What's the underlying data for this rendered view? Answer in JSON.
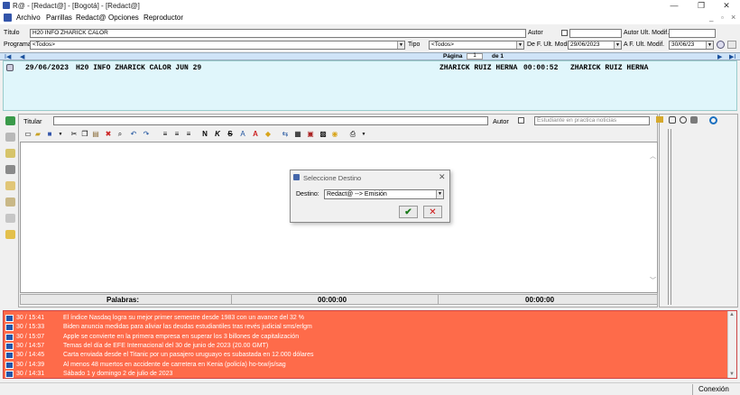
{
  "window": {
    "title": "R@ - [Redact@] - [Bogotá] - [Redact@]",
    "minimize": "—",
    "restore": "❐",
    "close": "✕",
    "child_controls": [
      "_",
      "▫",
      "×"
    ]
  },
  "menu": [
    "Archivo",
    "Parrillas",
    "Redact@",
    "Opciones",
    "Reproductor"
  ],
  "form": {
    "titulo_label": "Título",
    "titulo_value": "H20 INFO ZHARICK CALOR",
    "autor_label": "Autor",
    "autor_ult_modif_label": "Autor Ult. Modif.",
    "programa_label": "Programa",
    "programa_value": "<Todos>",
    "tipo_label": "Tipo",
    "tipo_value": "<Todos>",
    "de_f_label": "De F. Ult. Modif.",
    "de_f_value": "29/06/2023",
    "a_f_label": "A F. Ult. Modif.",
    "a_f_value": "30/06/23"
  },
  "nav": {
    "first": "I◀",
    "prev": "◀",
    "pagina_label": "Página",
    "pagina_value": "1",
    "de_label": "de 1",
    "next": "▶",
    "last": "▶I"
  },
  "news_item": {
    "date": "29/06/2023",
    "title": "H20 INFO ZHARICK CALOR JUN 29",
    "author": "ZHARICK RUIZ HERNA",
    "duration": "00:00:52",
    "modifier": "ZHARICK RUIZ HERNA"
  },
  "editor": {
    "titular_label": "Titular",
    "titular_value": "",
    "autor_label": "Autor",
    "autor_value": "Estudiante en practica noticias",
    "toolbar": [
      "new",
      "open",
      "save",
      "cut",
      "copy",
      "paste",
      "delete",
      "find",
      "undo",
      "redo",
      "align-left",
      "align-center",
      "align-right",
      "bold",
      "italic",
      "strike",
      "font",
      "color",
      "highlight"
    ],
    "bold_glyph": "N",
    "italic_glyph": "K",
    "strike_glyph": "S",
    "palabras_label": "Palabras:",
    "time1": "00:00:00",
    "time2": "00:00:00"
  },
  "dialog": {
    "title": "Seleccione Destino",
    "destino_label": "Destino:",
    "destino_value": "Redact@ --> Emisión",
    "ok": "✔",
    "cancel": "✕"
  },
  "ticker": [
    {
      "time": "30 / 15:41",
      "text": "El índice Nasdaq logra su mejor primer semestre desde 1983 con un avance del 32 %"
    },
    {
      "time": "30 / 15:33",
      "text": "Biden anuncia medidas para aliviar las deudas estudiantiles tras revés judicial sms/erlgm"
    },
    {
      "time": "30 / 15:07",
      "text": "Apple se convierte en la primera empresa en superar los 3 billones de capitalización"
    },
    {
      "time": "30 / 14:57",
      "text": "Temas del día de EFE Internacional del 30 de junio de 2023 (20.00 GMT)"
    },
    {
      "time": "30 / 14:45",
      "text": "Carta enviada desde el Titanic por un pasajero uruguayo es subastada en 12.000 dólares"
    },
    {
      "time": "30 / 14:39",
      "text": "Al menos 48 muertos en accidente de carretera en Kenia (policía) ho-txw/js/sag"
    },
    {
      "time": "30 / 14:31",
      "text": "Sábado 1 y domingo 2 de julio de 2023"
    }
  ],
  "footer": {
    "status": "Conexión"
  },
  "colors": {
    "ticker_bg": "#fe6b4a",
    "news_bg": "#e0f6fb",
    "nav_bg": "#cfe3f7"
  }
}
